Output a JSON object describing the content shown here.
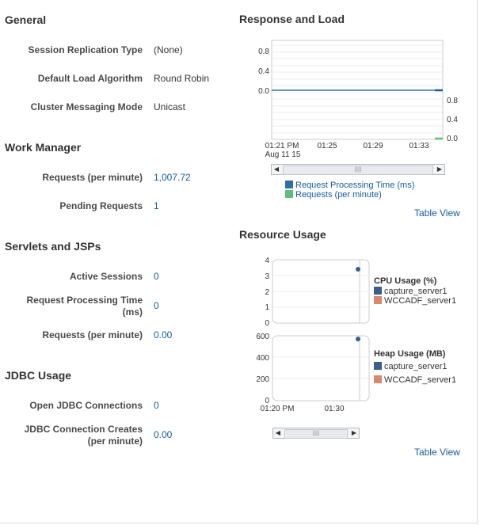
{
  "general": {
    "title": "General",
    "rows": [
      {
        "label": "Session Replication Type",
        "value": "(None)"
      },
      {
        "label": "Default Load Algorithm",
        "value": "Round Robin"
      },
      {
        "label": "Cluster Messaging Mode",
        "value": "Unicast"
      }
    ]
  },
  "work_manager": {
    "title": "Work Manager",
    "rows": [
      {
        "label": "Requests (per minute)",
        "value": "1,007.72"
      },
      {
        "label": "Pending Requests",
        "value": "1"
      }
    ]
  },
  "servlets": {
    "title": "Servlets and JSPs",
    "rows": [
      {
        "label": "Active Sessions",
        "value": "0"
      },
      {
        "label": "Request Processing Time (ms)",
        "value": "0"
      },
      {
        "label": "Requests (per minute)",
        "value": "0.00"
      }
    ]
  },
  "jdbc": {
    "title": "JDBC Usage",
    "rows": [
      {
        "label": "Open JDBC Connections",
        "value": "0"
      },
      {
        "label": "JDBC Connection Creates (per minute)",
        "value": "0.00"
      }
    ]
  },
  "response_load": {
    "title": "Response and Load",
    "table_view": "Table View",
    "x_ticks": [
      "01:21 PM",
      "01:25",
      "01:29",
      "01:33"
    ],
    "x_date": "Aug 11 15",
    "y_left_ticks": [
      "0.8",
      "0.4",
      "0.0"
    ],
    "y_right_ticks": [
      "0.8",
      "0.4",
      "0.0"
    ],
    "legend": [
      {
        "name": "Request Processing Time (ms)",
        "color": "#2d6ea3"
      },
      {
        "name": "Requests (per minute)",
        "color": "#5cbf7a"
      }
    ]
  },
  "resource_usage": {
    "title": "Resource Usage",
    "table_view": "Table View",
    "cpu": {
      "title": "CPU Usage (%)",
      "y_ticks": [
        "4",
        "3",
        "2",
        "1",
        "0"
      ],
      "legend": [
        {
          "name": "capture_server1",
          "color": "#3b5f86"
        },
        {
          "name": "WCCADF_server1",
          "color": "#d9896b"
        }
      ]
    },
    "heap": {
      "title": "Heap Usage (MB)",
      "y_ticks": [
        "600",
        "400",
        "200",
        "0"
      ],
      "legend": [
        {
          "name": "capture_server1",
          "color": "#3b5f86"
        },
        {
          "name": "WCCADF_server1",
          "color": "#d9896b"
        }
      ]
    },
    "x_ticks": [
      "01:20 PM",
      "01:30"
    ]
  },
  "chart_data": [
    {
      "type": "line",
      "title": "Response and Load",
      "x": [
        "01:21 PM",
        "01:25",
        "01:29",
        "01:33"
      ],
      "ylim": [
        0,
        0.8
      ],
      "series": [
        {
          "name": "Request Processing Time (ms)",
          "values": [
            0,
            0,
            0,
            0
          ]
        },
        {
          "name": "Requests (per minute)",
          "values": [
            0,
            0,
            0,
            0
          ]
        }
      ]
    },
    {
      "type": "scatter",
      "title": "CPU Usage (%)",
      "ylim": [
        0,
        4
      ],
      "series": [
        {
          "name": "capture_server1",
          "x": [
            "01:32"
          ],
          "values": [
            3.4
          ]
        }
      ]
    },
    {
      "type": "scatter",
      "title": "Heap Usage (MB)",
      "ylim": [
        0,
        600
      ],
      "series": [
        {
          "name": "capture_server1",
          "x": [
            "01:32"
          ],
          "values": [
            570
          ]
        }
      ]
    }
  ]
}
